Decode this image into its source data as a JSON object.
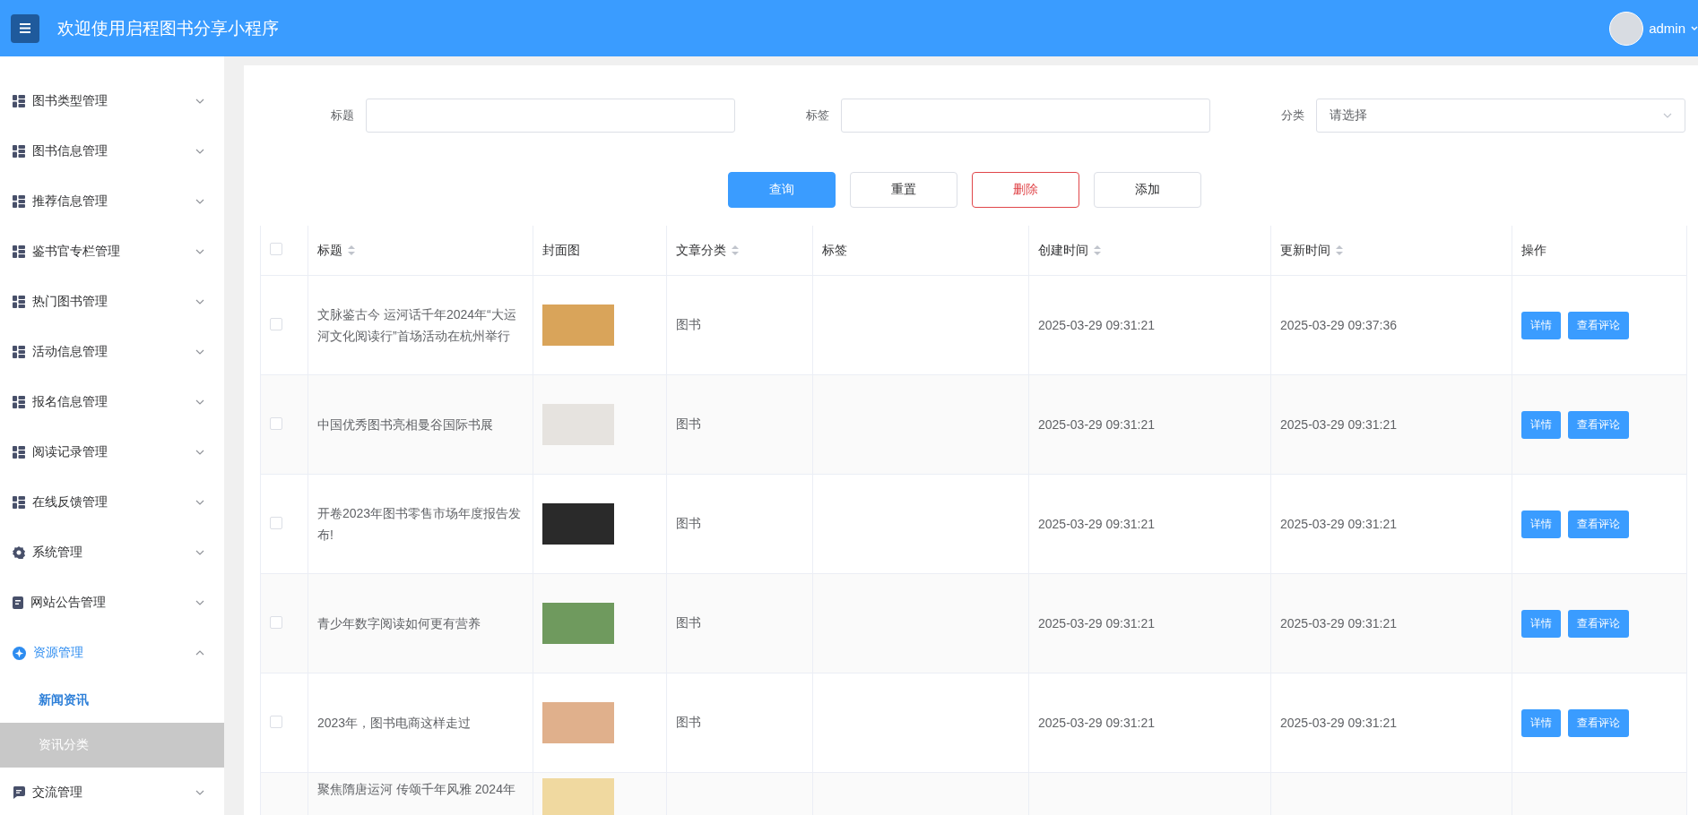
{
  "header": {
    "title": "欢迎使用启程图书分享小程序",
    "user": "admin"
  },
  "sidebar": {
    "items": [
      {
        "label": "图书类型管理",
        "kind": "grid",
        "expanded": false
      },
      {
        "label": "图书信息管理",
        "kind": "grid",
        "expanded": false
      },
      {
        "label": "推荐信息管理",
        "kind": "grid",
        "expanded": false
      },
      {
        "label": "鉴书官专栏管理",
        "kind": "grid",
        "expanded": false
      },
      {
        "label": "热门图书管理",
        "kind": "grid",
        "expanded": false
      },
      {
        "label": "活动信息管理",
        "kind": "grid",
        "expanded": false
      },
      {
        "label": "报名信息管理",
        "kind": "grid",
        "expanded": false
      },
      {
        "label": "阅读记录管理",
        "kind": "grid",
        "expanded": false
      },
      {
        "label": "在线反馈管理",
        "kind": "grid",
        "expanded": false
      },
      {
        "label": "系统管理",
        "kind": "gear",
        "expanded": false
      },
      {
        "label": "网站公告管理",
        "kind": "doc",
        "expanded": false
      },
      {
        "label": "资源管理",
        "kind": "star",
        "expanded": true,
        "children": [
          {
            "label": "新闻资讯",
            "selected": true,
            "hovered": false
          },
          {
            "label": "资讯分类",
            "selected": false,
            "hovered": true
          }
        ]
      },
      {
        "label": "交流管理",
        "kind": "chat",
        "expanded": false
      }
    ]
  },
  "filters": [
    {
      "label": "标题",
      "kind": "input"
    },
    {
      "label": "标签",
      "kind": "input"
    },
    {
      "label": "分类",
      "kind": "select",
      "placeholder": "请选择"
    }
  ],
  "buttons": [
    {
      "label": "查询",
      "kind": "primary"
    },
    {
      "label": "重置",
      "kind": "default"
    },
    {
      "label": "删除",
      "kind": "danger"
    },
    {
      "label": "添加",
      "kind": "default"
    }
  ],
  "table": {
    "select_all_checked": false,
    "columns": [
      {
        "label": "标题",
        "sortable": true
      },
      {
        "label": "封面图",
        "sortable": false
      },
      {
        "label": "文章分类",
        "sortable": true
      },
      {
        "label": "标签",
        "sortable": false
      },
      {
        "label": "创建时间",
        "sortable": true
      },
      {
        "label": "更新时间",
        "sortable": true
      },
      {
        "label": "操作",
        "sortable": false
      }
    ],
    "rows": [
      {
        "kind": "full",
        "checked": false,
        "title": "文脉鉴古今 运河话千年2024年“大运河文化阅读行”首场活动在杭州举行",
        "category": "图书",
        "created": "2025-03-29 09:31:21",
        "updated": "2025-03-29 09:37:36",
        "actions": [
          "详情",
          "查看评论"
        ]
      },
      {
        "kind": "full",
        "checked": false,
        "title": "中国优秀图书亮相曼谷国际书展",
        "category": "图书",
        "created": "2025-03-29 09:31:21",
        "updated": "2025-03-29 09:31:21",
        "actions": [
          "详情",
          "查看评论"
        ]
      },
      {
        "kind": "full",
        "checked": false,
        "title": "开卷2023年图书零售市场年度报告发布!",
        "category": "图书",
        "created": "2025-03-29 09:31:21",
        "updated": "2025-03-29 09:31:21",
        "actions": [
          "详情",
          "查看评论"
        ]
      },
      {
        "kind": "full",
        "checked": false,
        "title": "青少年数字阅读如何更有营养",
        "category": "图书",
        "created": "2025-03-29 09:31:21",
        "updated": "2025-03-29 09:31:21",
        "actions": [
          "详情",
          "查看评论"
        ]
      },
      {
        "kind": "full",
        "checked": false,
        "title": "2023年，图书电商这样走过",
        "category": "图书",
        "created": "2025-03-29 09:31:21",
        "updated": "2025-03-29 09:31:21",
        "actions": [
          "详情",
          "查看评论"
        ]
      },
      {
        "kind": "partial",
        "title": "聚焦隋唐运河 传颂千年风雅 2024年"
      }
    ]
  }
}
